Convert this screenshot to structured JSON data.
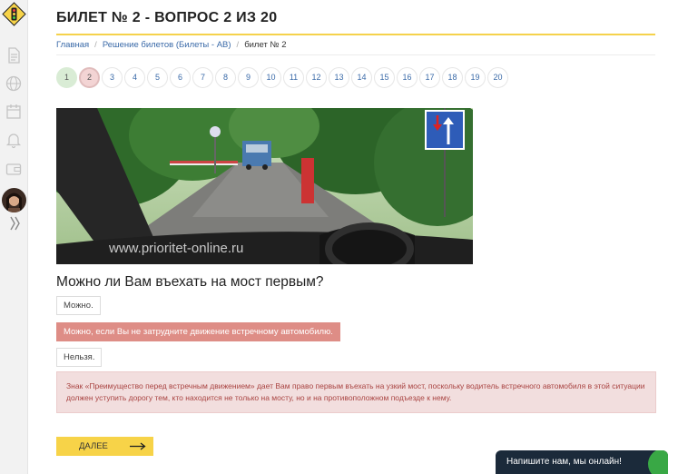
{
  "header": {
    "title": "БИЛЕТ № 2 - ВОПРОС 2 ИЗ 20"
  },
  "breadcrumb": {
    "items": [
      "Главная",
      "Решение билетов (Билеты - АВ)"
    ],
    "current": "билет № 2"
  },
  "question_nav": {
    "numbers": [
      "1",
      "2",
      "3",
      "4",
      "5",
      "6",
      "7",
      "8",
      "9",
      "10",
      "11",
      "12",
      "13",
      "14",
      "15",
      "16",
      "17",
      "18",
      "19",
      "20"
    ],
    "answered_correct": [
      "1"
    ],
    "current": "2"
  },
  "scene": {
    "watermark": "www.prioritet-online.ru"
  },
  "question": {
    "text": "Можно ли Вам въехать на мост первым?",
    "options": [
      {
        "label": "Можно.",
        "state": "default"
      },
      {
        "label": "Можно, если Вы не затрудните движение встречному автомобилю.",
        "state": "wrong"
      },
      {
        "label": "Нельзя.",
        "state": "default"
      }
    ]
  },
  "explanation": {
    "text": "Знак «Преимущество перед встречным движением» дает Вам право первым въехать на узкий мост, поскольку водитель встречного автомобиля в этой ситуации должен уступить дорогу тем, кто находится не только на мосту, но и на противоположном подъезде к нему."
  },
  "actions": {
    "next_label": "ДАЛЕЕ"
  },
  "chat": {
    "label": "Напишите нам, мы онлайн!"
  },
  "sidebar": {
    "icons": [
      "logo-icon",
      "document-icon",
      "globe-icon",
      "calendar-icon",
      "bell-icon",
      "wallet-icon",
      "avatar",
      "expand-icon"
    ]
  },
  "colors": {
    "accent": "#f7d348",
    "link": "#3a6aa8",
    "wrong": "#de8d86",
    "correct_nav": "#d9ecd5",
    "error_text": "#a94442",
    "chat_bg": "#1b2a3a"
  }
}
